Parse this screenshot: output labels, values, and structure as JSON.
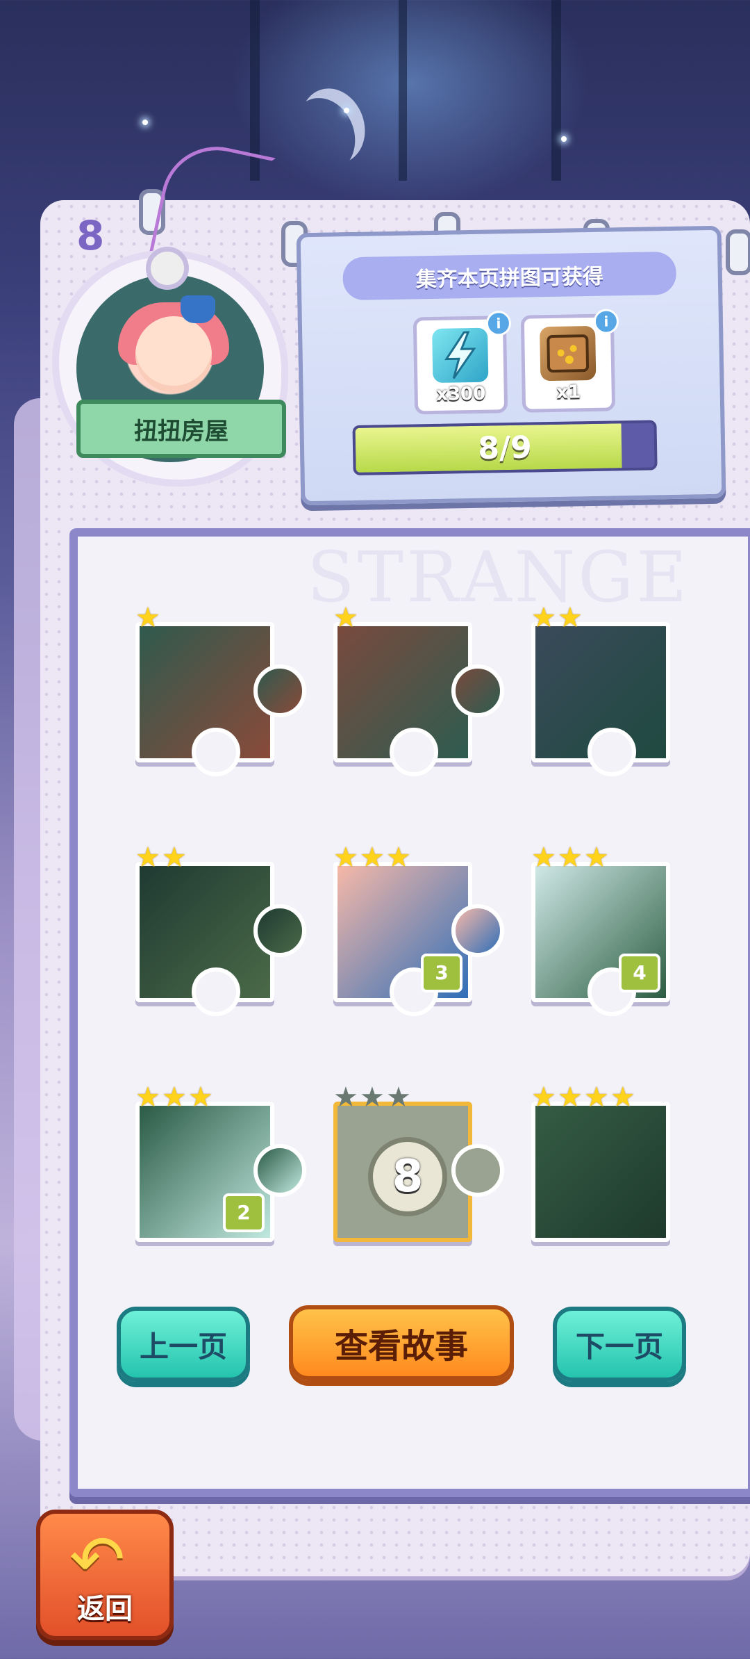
{
  "page_number": "8",
  "badge": {
    "title": "扭扭房屋"
  },
  "reward": {
    "title": "集齐本页拼图可获得",
    "items": [
      {
        "icon": "lightning-icon",
        "count": "x300"
      },
      {
        "icon": "treasure-box-icon",
        "count": "x1"
      }
    ],
    "info_symbol": "i",
    "progress": {
      "text": "8/9",
      "value": 0.89
    }
  },
  "board": {
    "watermark": "STRANGE",
    "pieces": [
      {
        "stars": 1,
        "star_glyph": "★",
        "number": "",
        "locked": false
      },
      {
        "stars": 1,
        "star_glyph": "★",
        "number": "",
        "locked": false
      },
      {
        "stars": 2,
        "star_glyph": "★",
        "number": "",
        "locked": false
      },
      {
        "stars": 2,
        "star_glyph": "★",
        "number": "",
        "locked": false
      },
      {
        "stars": 3,
        "star_glyph": "★",
        "number": "3",
        "locked": false
      },
      {
        "stars": 3,
        "star_glyph": "★",
        "number": "4",
        "locked": false
      },
      {
        "stars": 3,
        "star_glyph": "★",
        "number": "2",
        "locked": false
      },
      {
        "stars": 3,
        "star_glyph": "★",
        "number": "8",
        "locked": true
      },
      {
        "stars": 4,
        "star_glyph": "★",
        "number": "",
        "locked": false
      }
    ]
  },
  "buttons": {
    "prev": "上一页",
    "story": "查看故事",
    "next": "下一页"
  },
  "back": {
    "arrow": "↶",
    "label": "返回"
  },
  "colors": {
    "accent_teal": "#24c4ae",
    "accent_orange": "#ff8a1e",
    "progress_fill": "#b7d94a",
    "star": "#ffd21c"
  }
}
